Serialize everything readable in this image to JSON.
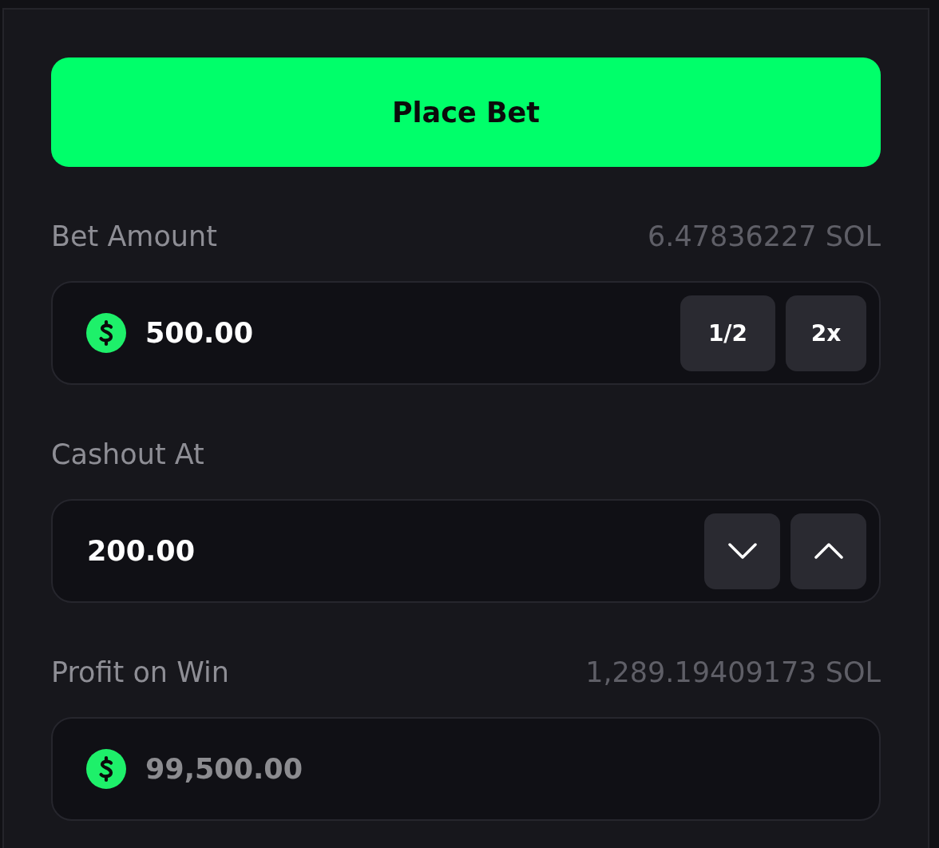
{
  "place_bet_button": {
    "label": "Place Bet"
  },
  "fields": [
    {
      "label": "Bet Amount",
      "aside": "6.47836227 SOL",
      "value": "500.00",
      "currency_icon": true,
      "disabled": false,
      "actions": [
        {
          "kind": "text",
          "label": "1/2"
        },
        {
          "kind": "text",
          "label": "2x"
        }
      ]
    },
    {
      "label": "Cashout At",
      "value": "200.00",
      "currency_icon": false,
      "disabled": false,
      "actions": [
        {
          "kind": "down"
        },
        {
          "kind": "up"
        }
      ]
    },
    {
      "label": "Profit on Win",
      "aside": "1,289.19409173 SOL",
      "value": "99,500.00",
      "currency_icon": true,
      "disabled": true
    }
  ]
}
